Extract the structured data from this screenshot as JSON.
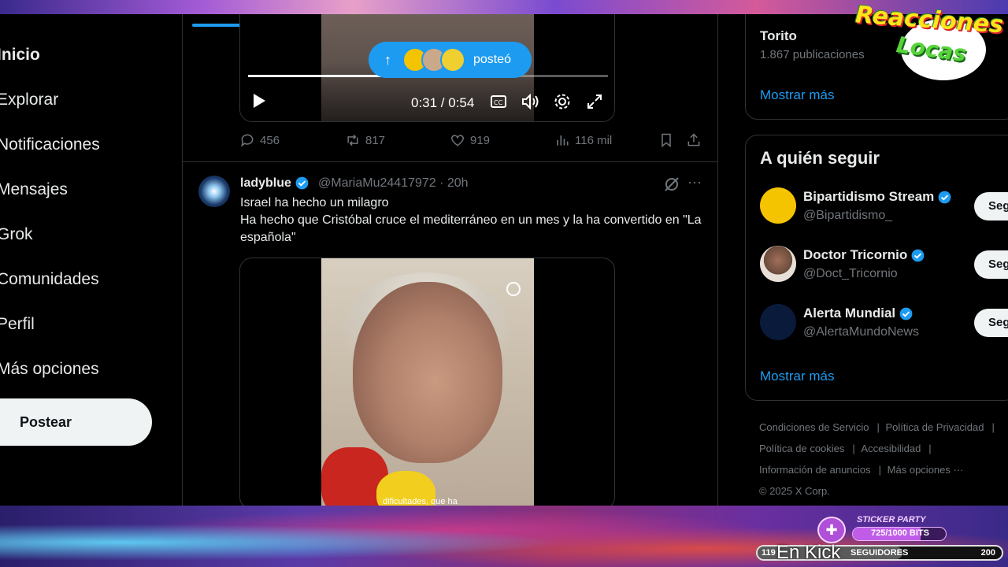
{
  "sidebar": {
    "items": [
      {
        "label": "Inicio"
      },
      {
        "label": "Explorar"
      },
      {
        "label": "Notificaciones"
      },
      {
        "label": "Mensajes"
      },
      {
        "label": "Grok"
      },
      {
        "label": "Comunidades"
      },
      {
        "label": "Perfil"
      },
      {
        "label": "Más opciones"
      }
    ],
    "post_button": "Postear"
  },
  "video1": {
    "time": "0:31 / 0:54",
    "progress": 0.57,
    "posted_pill": "posteó"
  },
  "tweet1_actions": {
    "replies": "456",
    "reposts": "817",
    "likes": "919",
    "views": "116 mil"
  },
  "tweet2": {
    "name": "ladyblue",
    "handle_time": "@MariaMu24417972 · 20h",
    "text_line1": "Israel ha hecho un milagro",
    "text_line2": "Ha hecho que Cristóbal cruce el mediterráneo en un mes y la ha convertido en \"La española\"",
    "video_subtitle": "dificultades, que ha"
  },
  "trending": {
    "title": "Torito",
    "count": "1.867 publicaciones",
    "show_more": "Mostrar más"
  },
  "who_to_follow": {
    "title": "A quién seguir",
    "follow_label": "Seg",
    "accounts": [
      {
        "name": "Bipartidismo Stream",
        "handle": "@Bipartidismo_",
        "avatar_color": "#f5c400"
      },
      {
        "name": "Doctor Tricornio",
        "handle": "@Doct_Tricornio",
        "avatar_color": "#c9b8a8"
      },
      {
        "name": "Alerta Mundial",
        "handle": "@AlertaMundoNews",
        "avatar_color": "#0a1a3a"
      }
    ],
    "show_more": "Mostrar más"
  },
  "footer": {
    "links": [
      "Condiciones de Servicio",
      "Política de Privacidad",
      "Política de cookies",
      "Accesibilidad",
      "Información de anuncios",
      "Más opciones ···"
    ],
    "copyright": "© 2025 X Corp."
  },
  "overlay": {
    "logo_line1": "Reacciones",
    "logo_line2": "Locas",
    "sticker_title": "STICKER PARTY",
    "bits_text": "725/1000 BITS",
    "bits_progress": 0.725,
    "followers_current": "119",
    "followers_label": "SEGUIDORES",
    "followers_goal": "200",
    "followers_progress": 0.595,
    "kick_label": "En Kick"
  },
  "colors": {
    "accent": "#1d9bf0",
    "background": "#000000",
    "text_secondary": "#71767b"
  }
}
